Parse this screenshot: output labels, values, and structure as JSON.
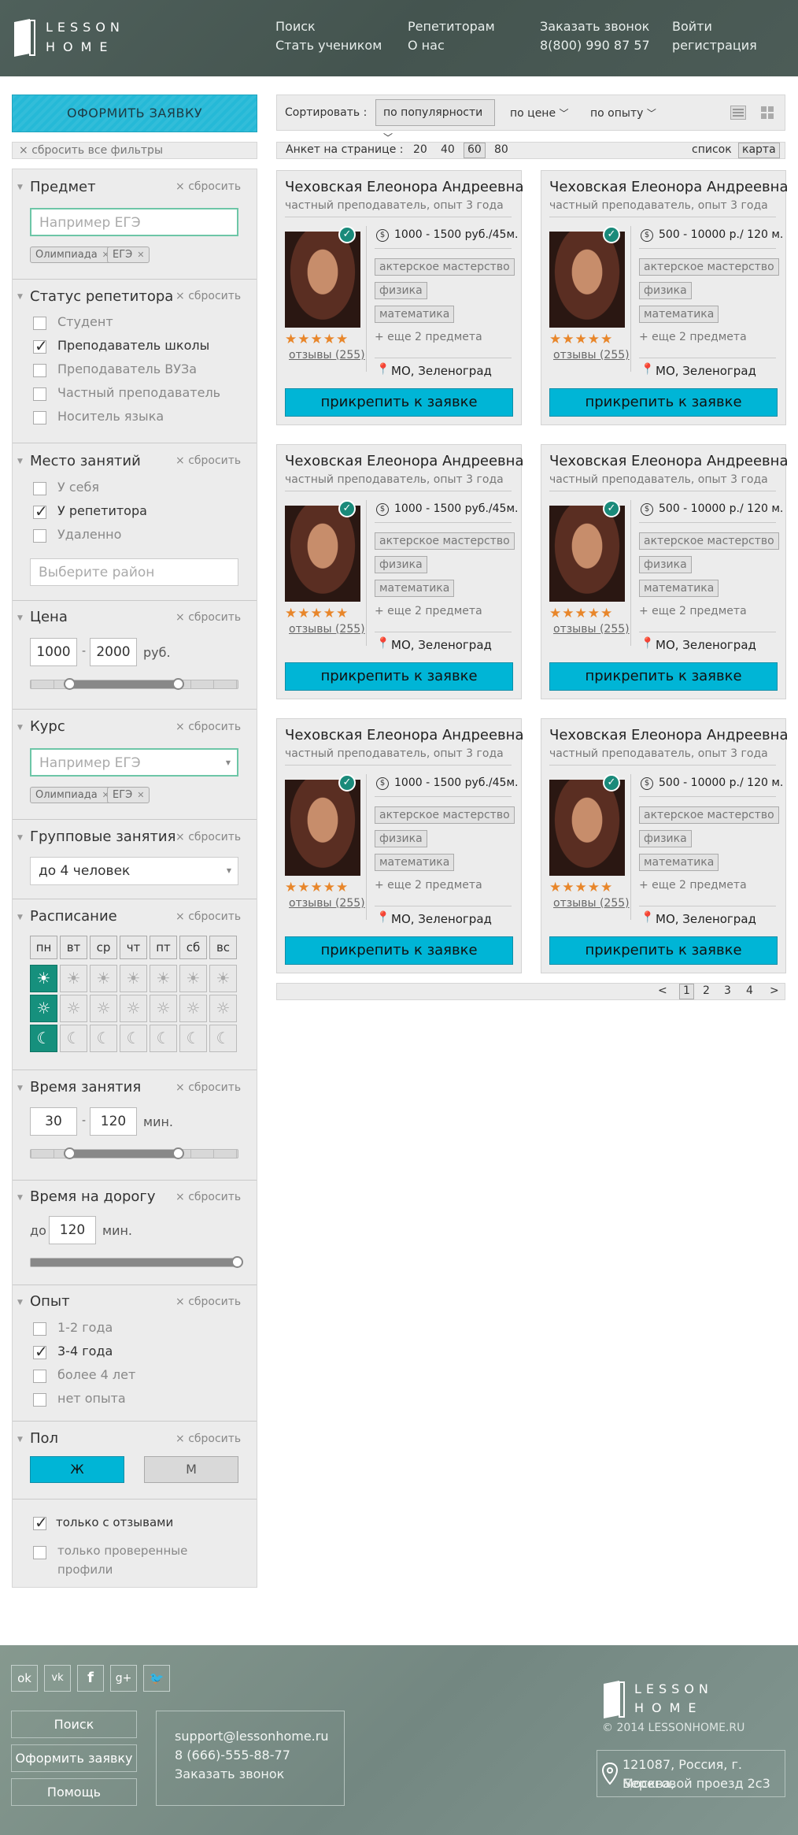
{
  "header": {
    "logo_line1": "LESSON",
    "logo_line2": "HOME",
    "nav": {
      "search": "Поиск",
      "become_student": "Стать учеником",
      "for_tutors": "Репетиторам",
      "about": "О нас",
      "order_call": "Заказать звонок",
      "phone": "8(800) 990 87 57",
      "login": "Войти",
      "register": "регистрация"
    }
  },
  "sidebar": {
    "order_button": "ОФОРМИТЬ ЗАЯВКУ",
    "reset_all": "сбросить все фильтры",
    "reset_label": "сбросить",
    "subject": {
      "title": "Предмет",
      "placeholder": "Например ЕГЭ",
      "tags": [
        "Олимпиада",
        "ЕГЭ"
      ]
    },
    "tutor_status": {
      "title": "Статус репетитора",
      "options": [
        {
          "label": "Студент",
          "checked": false
        },
        {
          "label": "Преподаватель школы",
          "checked": true
        },
        {
          "label": "Преподаватель ВУЗа",
          "checked": false
        },
        {
          "label": "Частный преподаватель",
          "checked": false
        },
        {
          "label": "Носитель языка",
          "checked": false
        }
      ]
    },
    "place": {
      "title": "Место занятий",
      "options": [
        {
          "label": "У себя",
          "checked": false
        },
        {
          "label": "У репетитора",
          "checked": true
        },
        {
          "label": "Удаленно",
          "checked": false
        }
      ],
      "district_placeholder": "Выберите район"
    },
    "price": {
      "title": "Цена",
      "from": "1000",
      "to": "2000",
      "unit": "руб.",
      "range_fraction": [
        0.19,
        0.71
      ]
    },
    "course": {
      "title": "Курс",
      "placeholder": "Например ЕГЭ",
      "tags": [
        "Олимпиада",
        "ЕГЭ"
      ]
    },
    "group": {
      "title": "Групповые занятия",
      "value": "до 4 человек"
    },
    "schedule": {
      "title": "Расписание",
      "days": [
        "пн",
        "вт",
        "ср",
        "чт",
        "пт",
        "сб",
        "вс"
      ],
      "selected_day": "пн",
      "rows": [
        "morning",
        "day",
        "evening"
      ]
    },
    "lesson_time": {
      "title": "Время занятия",
      "from": "30",
      "to": "120",
      "unit": "мин.",
      "range_fraction": [
        0.19,
        0.71
      ]
    },
    "travel_time": {
      "title": "Время на дорогу",
      "prefix": "до",
      "value": "120",
      "unit": "мин.",
      "fraction": 1.0
    },
    "experience": {
      "title": "Опыт",
      "options": [
        {
          "label": "1-2 года",
          "checked": false
        },
        {
          "label": "3-4 года",
          "checked": true
        },
        {
          "label": "более 4 лет",
          "checked": false
        },
        {
          "label": "нет опыта",
          "checked": false
        }
      ]
    },
    "gender": {
      "title": "Пол",
      "female": "Ж",
      "male": "М",
      "selected": "Ж"
    },
    "with_reviews": {
      "label": "только с отзывами",
      "checked": true
    },
    "verified_line1": "только проверенные",
    "verified_line2": "профили"
  },
  "toolbar": {
    "sort_label": "Сортировать :",
    "sort_popularity": "по популярности",
    "sort_price": "по цене",
    "sort_experience": "по опыту",
    "per_page_label": "Анкет на странице :",
    "per_page": [
      "20",
      "40",
      "60",
      "80"
    ],
    "per_page_selected": "60",
    "view_list": "список",
    "view_map": "карта"
  },
  "cards": [
    {
      "name": "Чеховская Елеонора Андреевна",
      "subtitle": "частный преподаватель, опыт 3 года",
      "price": "1000 - 1500 руб./45м.",
      "subjects": [
        "актерское мастерство",
        "физика",
        "математика"
      ],
      "more": "+ еще 2 предмета",
      "reviews": "отзывы (255)",
      "location": "МО, Зеленоград",
      "button": "прикрепить к заявке",
      "rating": 5
    },
    {
      "name": "Чеховская Елеонора Андреевна",
      "subtitle": "частный преподаватель, опыт 3 года",
      "price": "500 - 10000 р./ 120 м.",
      "subjects": [
        "актерское мастерство",
        "физика",
        "математика"
      ],
      "more": "+ еще 2 предмета",
      "reviews": "отзывы (255)",
      "location": "МО, Зеленоград",
      "button": "прикрепить к заявке",
      "rating": 5
    },
    {
      "name": "Чеховская Елеонора Андреевна",
      "subtitle": "частный преподаватель, опыт 3 года",
      "price": "1000 - 1500 руб./45м.",
      "subjects": [
        "актерское мастерство",
        "физика",
        "математика"
      ],
      "more": "+ еще 2 предмета",
      "reviews": "отзывы (255)",
      "location": "МО, Зеленоград",
      "button": "прикрепить к заявке",
      "rating": 5
    },
    {
      "name": "Чеховская Елеонора Андреевна",
      "subtitle": "частный преподаватель, опыт 3 года",
      "price": "500 - 10000 р./ 120 м.",
      "subjects": [
        "актерское мастерство",
        "физика",
        "математика"
      ],
      "more": "+ еще 2 предмета",
      "reviews": "отзывы (255)",
      "location": "МО, Зеленоград",
      "button": "прикрепить к заявке",
      "rating": 5
    },
    {
      "name": "Чеховская Елеонора Андреевна",
      "subtitle": "частный преподаватель, опыт 3 года",
      "price": "1000 - 1500 руб./45м.",
      "subjects": [
        "актерское мастерство",
        "физика",
        "математика"
      ],
      "more": "+ еще 2 предмета",
      "reviews": "отзывы (255)",
      "location": "МО, Зеленоград",
      "button": "прикрепить к заявке",
      "rating": 5
    },
    {
      "name": "Чеховская Елеонора Андреевна",
      "subtitle": "частный преподаватель, опыт 3 года",
      "price": "500 - 10000 р./ 120 м.",
      "subjects": [
        "актерское мастерство",
        "физика",
        "математика"
      ],
      "more": "+ еще 2 предмета",
      "reviews": "отзывы (255)",
      "location": "МО, Зеленоград",
      "button": "прикрепить к заявке",
      "rating": 5
    }
  ],
  "pagination": {
    "prev": "<",
    "pages": [
      "1",
      "2",
      "3",
      "4"
    ],
    "current": "1",
    "next": ">"
  },
  "footer": {
    "social_icons": [
      "odnoklassniki-icon",
      "vk-icon",
      "facebook-icon",
      "google-plus-icon",
      "twitter-icon"
    ],
    "buttons": [
      "Поиск",
      "Оформить заявку",
      "Помощь"
    ],
    "email": "support@lessonhome.ru",
    "phone": "8 (666)-555-88-77",
    "order_call": "Заказать звонок",
    "logo_line1": "LESSON",
    "logo_line2": "HOME",
    "copyright": "© 2014 LESSONHOME.RU",
    "address_line1": "121087, Россия, г. Москва,",
    "address_line2": "Береговой проезд 2с3"
  },
  "colors": {
    "accent": "#00b5d6",
    "teal": "#16907d",
    "header": "#4a5a56",
    "footer": "#7d918b",
    "stars": "#e8862a"
  }
}
